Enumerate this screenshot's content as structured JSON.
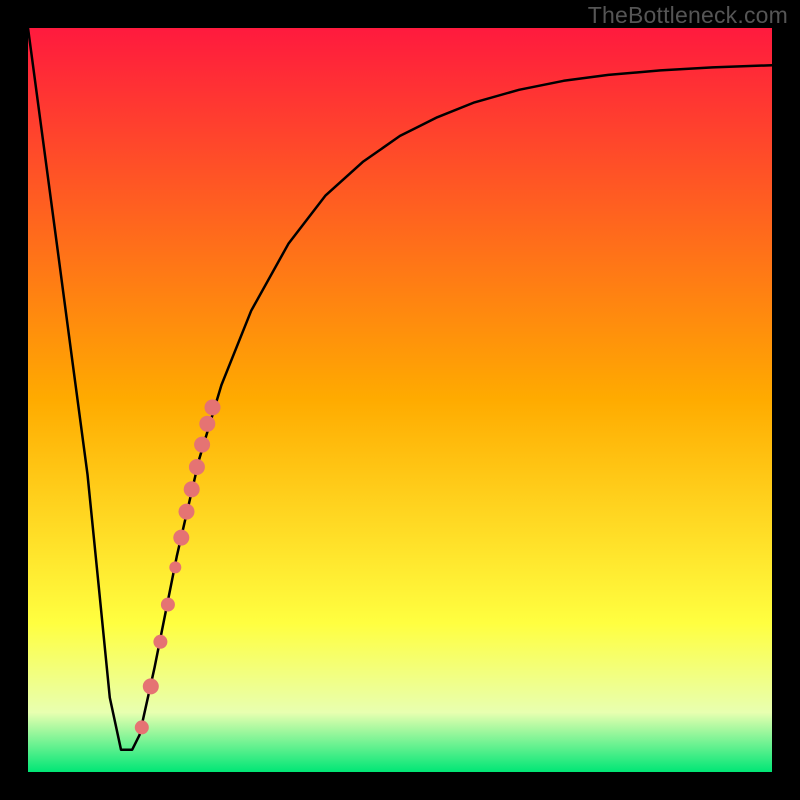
{
  "watermark": "TheBottleneck.com",
  "chart_data": {
    "type": "line",
    "title": "",
    "xlabel": "",
    "ylabel": "",
    "xlim": [
      0,
      100
    ],
    "ylim": [
      0,
      100
    ],
    "grid": false,
    "background": {
      "type": "vertical-gradient",
      "stops": [
        {
          "pos": 0.0,
          "color": "#ff1a3e"
        },
        {
          "pos": 0.5,
          "color": "#ffab00"
        },
        {
          "pos": 0.8,
          "color": "#ffff40"
        },
        {
          "pos": 0.92,
          "color": "#e8ffb0"
        },
        {
          "pos": 1.0,
          "color": "#00e676"
        }
      ]
    },
    "series": [
      {
        "name": "bottleneck-curve",
        "color": "#000000",
        "x": [
          0.0,
          2.0,
          4.0,
          6.0,
          8.0,
          9.5,
          11.0,
          12.5,
          14.0,
          15.0,
          17.0,
          20.0,
          23.0,
          26.0,
          30.0,
          35.0,
          40.0,
          45.0,
          50.0,
          55.0,
          60.0,
          66.0,
          72.0,
          78.0,
          85.0,
          92.0,
          100.0
        ],
        "y": [
          100.0,
          85.0,
          70.0,
          55.0,
          40.0,
          25.0,
          10.0,
          3.0,
          3.0,
          5.0,
          14.0,
          29.0,
          42.0,
          52.0,
          62.0,
          71.0,
          77.5,
          82.0,
          85.5,
          88.0,
          90.0,
          91.7,
          92.9,
          93.7,
          94.3,
          94.7,
          95.0
        ]
      }
    ],
    "markers": {
      "name": "highlight-points",
      "color": "#e57373",
      "points": [
        {
          "x": 15.3,
          "y": 6.0,
          "r": 7
        },
        {
          "x": 16.5,
          "y": 11.5,
          "r": 8
        },
        {
          "x": 17.8,
          "y": 17.5,
          "r": 7
        },
        {
          "x": 18.8,
          "y": 22.5,
          "r": 7
        },
        {
          "x": 19.8,
          "y": 27.5,
          "r": 6
        },
        {
          "x": 20.6,
          "y": 31.5,
          "r": 8
        },
        {
          "x": 21.3,
          "y": 35.0,
          "r": 8
        },
        {
          "x": 22.0,
          "y": 38.0,
          "r": 8
        },
        {
          "x": 22.7,
          "y": 41.0,
          "r": 8
        },
        {
          "x": 23.4,
          "y": 44.0,
          "r": 8
        },
        {
          "x": 24.1,
          "y": 46.8,
          "r": 8
        },
        {
          "x": 24.8,
          "y": 49.0,
          "r": 8
        }
      ]
    }
  }
}
